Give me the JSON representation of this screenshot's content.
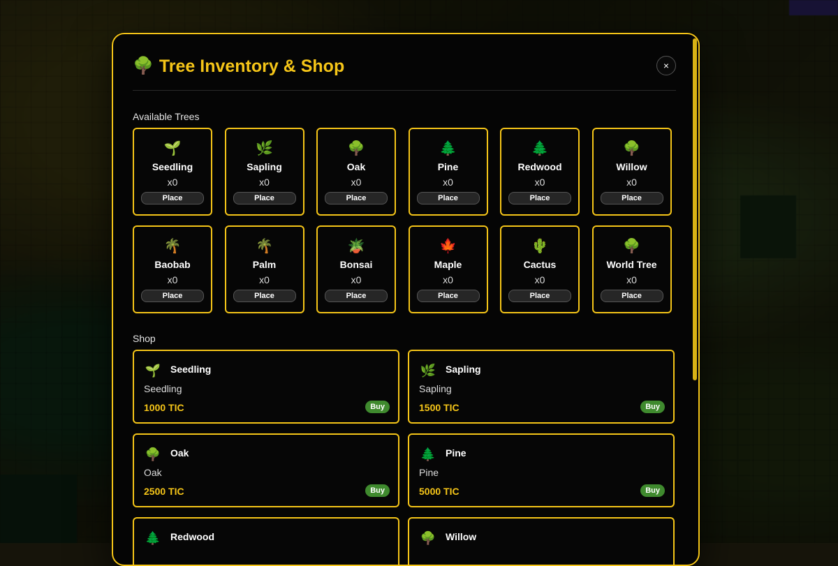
{
  "modal": {
    "title_icon": "🌳",
    "title": "Tree Inventory & Shop",
    "close_label": "×"
  },
  "inventory": {
    "label": "Available Trees",
    "items": [
      {
        "icon": "🌱",
        "name": "Seedling",
        "count": "x0",
        "action": "Place"
      },
      {
        "icon": "🌿",
        "name": "Sapling",
        "count": "x0",
        "action": "Place"
      },
      {
        "icon": "🌳",
        "name": "Oak",
        "count": "x0",
        "action": "Place"
      },
      {
        "icon": "🌲",
        "name": "Pine",
        "count": "x0",
        "action": "Place"
      },
      {
        "icon": "🌲",
        "name": "Redwood",
        "count": "x0",
        "action": "Place"
      },
      {
        "icon": "🌳",
        "name": "Willow",
        "count": "x0",
        "action": "Place"
      },
      {
        "icon": "🌴",
        "name": "Baobab",
        "count": "x0",
        "action": "Place"
      },
      {
        "icon": "🌴",
        "name": "Palm",
        "count": "x0",
        "action": "Place"
      },
      {
        "icon": "🪴",
        "name": "Bonsai",
        "count": "x0",
        "action": "Place"
      },
      {
        "icon": "🍁",
        "name": "Maple",
        "count": "x0",
        "action": "Place"
      },
      {
        "icon": "🌵",
        "name": "Cactus",
        "count": "x0",
        "action": "Place"
      },
      {
        "icon": "🌳",
        "name": "World Tree",
        "count": "x0",
        "action": "Place"
      }
    ]
  },
  "shop": {
    "label": "Shop",
    "items": [
      {
        "icon": "🌱",
        "name": "Seedling",
        "desc": "Seedling",
        "price": "1000 TIC",
        "action": "Buy"
      },
      {
        "icon": "🌿",
        "name": "Sapling",
        "desc": "Sapling",
        "price": "1500 TIC",
        "action": "Buy"
      },
      {
        "icon": "🌳",
        "name": "Oak",
        "desc": "Oak",
        "price": "2500 TIC",
        "action": "Buy"
      },
      {
        "icon": "🌲",
        "name": "Pine",
        "desc": "Pine",
        "price": "5000 TIC",
        "action": "Buy"
      },
      {
        "icon": "🌲",
        "name": "Redwood",
        "desc": "",
        "price": "",
        "action": ""
      },
      {
        "icon": "🌳",
        "name": "Willow",
        "desc": "",
        "price": "",
        "action": ""
      }
    ]
  },
  "colors": {
    "accent": "#f5c518",
    "buy_button": "#3f8a2e",
    "panel_bg": "#050505"
  }
}
